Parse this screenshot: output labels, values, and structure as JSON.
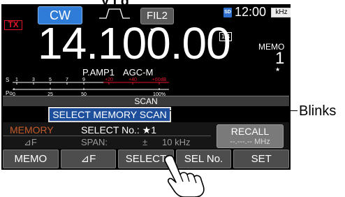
{
  "annotation": {
    "partial_heading": "y i g",
    "callout": "Blinks"
  },
  "status_bar": {
    "tx": "TX",
    "mode": "CW",
    "filter": "FIL2",
    "sd": "SD",
    "clock": "12:00",
    "unit": "kHz"
  },
  "display": {
    "frequency": "14.100.00",
    "step": "1/4",
    "memo_label": "MEMO",
    "memo_channel": "1",
    "memo_star": "★",
    "preamp": "P.AMP1",
    "agc": "AGC-M"
  },
  "meter": {
    "s_label": "S",
    "s_scale": [
      "1",
      "3",
      "5",
      "7",
      "9",
      "+20",
      "+40",
      "+60dB"
    ],
    "po_label": "Po",
    "po_scale": [
      "0",
      "25",
      "50",
      "100%"
    ]
  },
  "scan": {
    "title": "SCAN",
    "banner": "SELECT MEMORY SCAN",
    "memory_label": "MEMORY",
    "df_label": "⊿F",
    "select_no": "SELECT No.: ★1",
    "span_label": "SPAN:",
    "span_pm": "±",
    "span_value": "10 kHz",
    "recall_label": "RECALL",
    "recall_freq": "--.---.-- MHz"
  },
  "softkeys": [
    "MEMO",
    "⊿F",
    "SELECT",
    "SEL No.",
    "SET"
  ],
  "colors": {
    "tx_red": "#e0142a",
    "mode_blue": "#2f7cd8",
    "banner_blue": "#1d4f9c",
    "memory_orange": "#c45a2a",
    "meter_red": "#e0142a"
  }
}
